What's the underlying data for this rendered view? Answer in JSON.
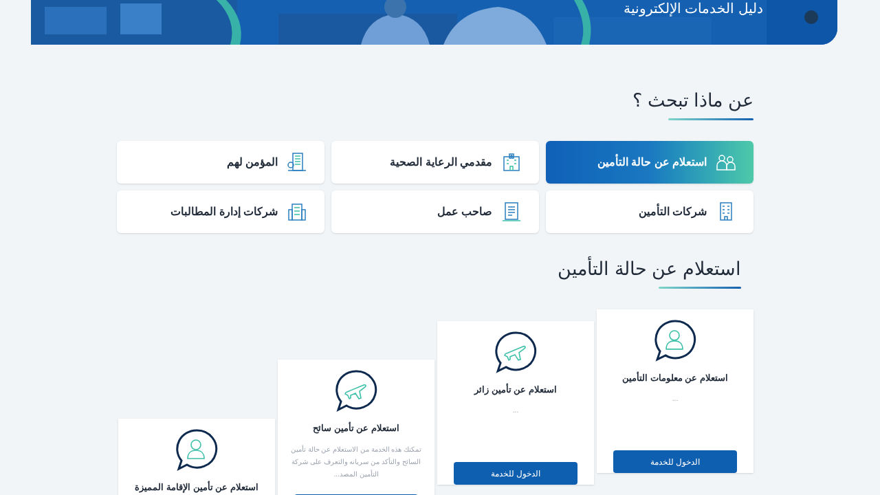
{
  "banner": {
    "title": "دليل الخدمات الإلكترونية"
  },
  "search_section": {
    "heading": "عن ماذا تبحث ؟",
    "categories": [
      {
        "label": "استعلام عن حالة التأمين",
        "kind": "people",
        "selected": true
      },
      {
        "label": "مقدمي الرعاية الصحية",
        "kind": "hospital",
        "selected": false
      },
      {
        "label": "المؤمن لهم",
        "kind": "city",
        "selected": false
      },
      {
        "label": "شركات التأمين",
        "kind": "building",
        "selected": false
      },
      {
        "label": "صاحب عمل",
        "kind": "document",
        "selected": false
      },
      {
        "label": "شركات إدارة المطالبات",
        "kind": "office",
        "selected": false
      }
    ]
  },
  "services_section": {
    "heading": "استعلام عن حالة التأمين",
    "cards": [
      {
        "title": "استعلام عن معلومات التأمين",
        "kind": "person",
        "description": "...",
        "button": "الدخول للخدمة"
      },
      {
        "title": "استعلام عن تأمين زائر",
        "kind": "plane",
        "description": "...",
        "button": "الدخول للخدمة"
      },
      {
        "title": "استعلام عن تأمين سائح",
        "kind": "plane",
        "description": "تمكنك هذه الخدمة من الاستعلام عن حالة تأمين السائح والتأكد من سريانه والتعرف على شركة التأمين المصد...",
        "button_peek": true
      },
      {
        "title": "استعلام عن تأمين الإقامة المميزة",
        "kind": "person"
      }
    ]
  }
}
